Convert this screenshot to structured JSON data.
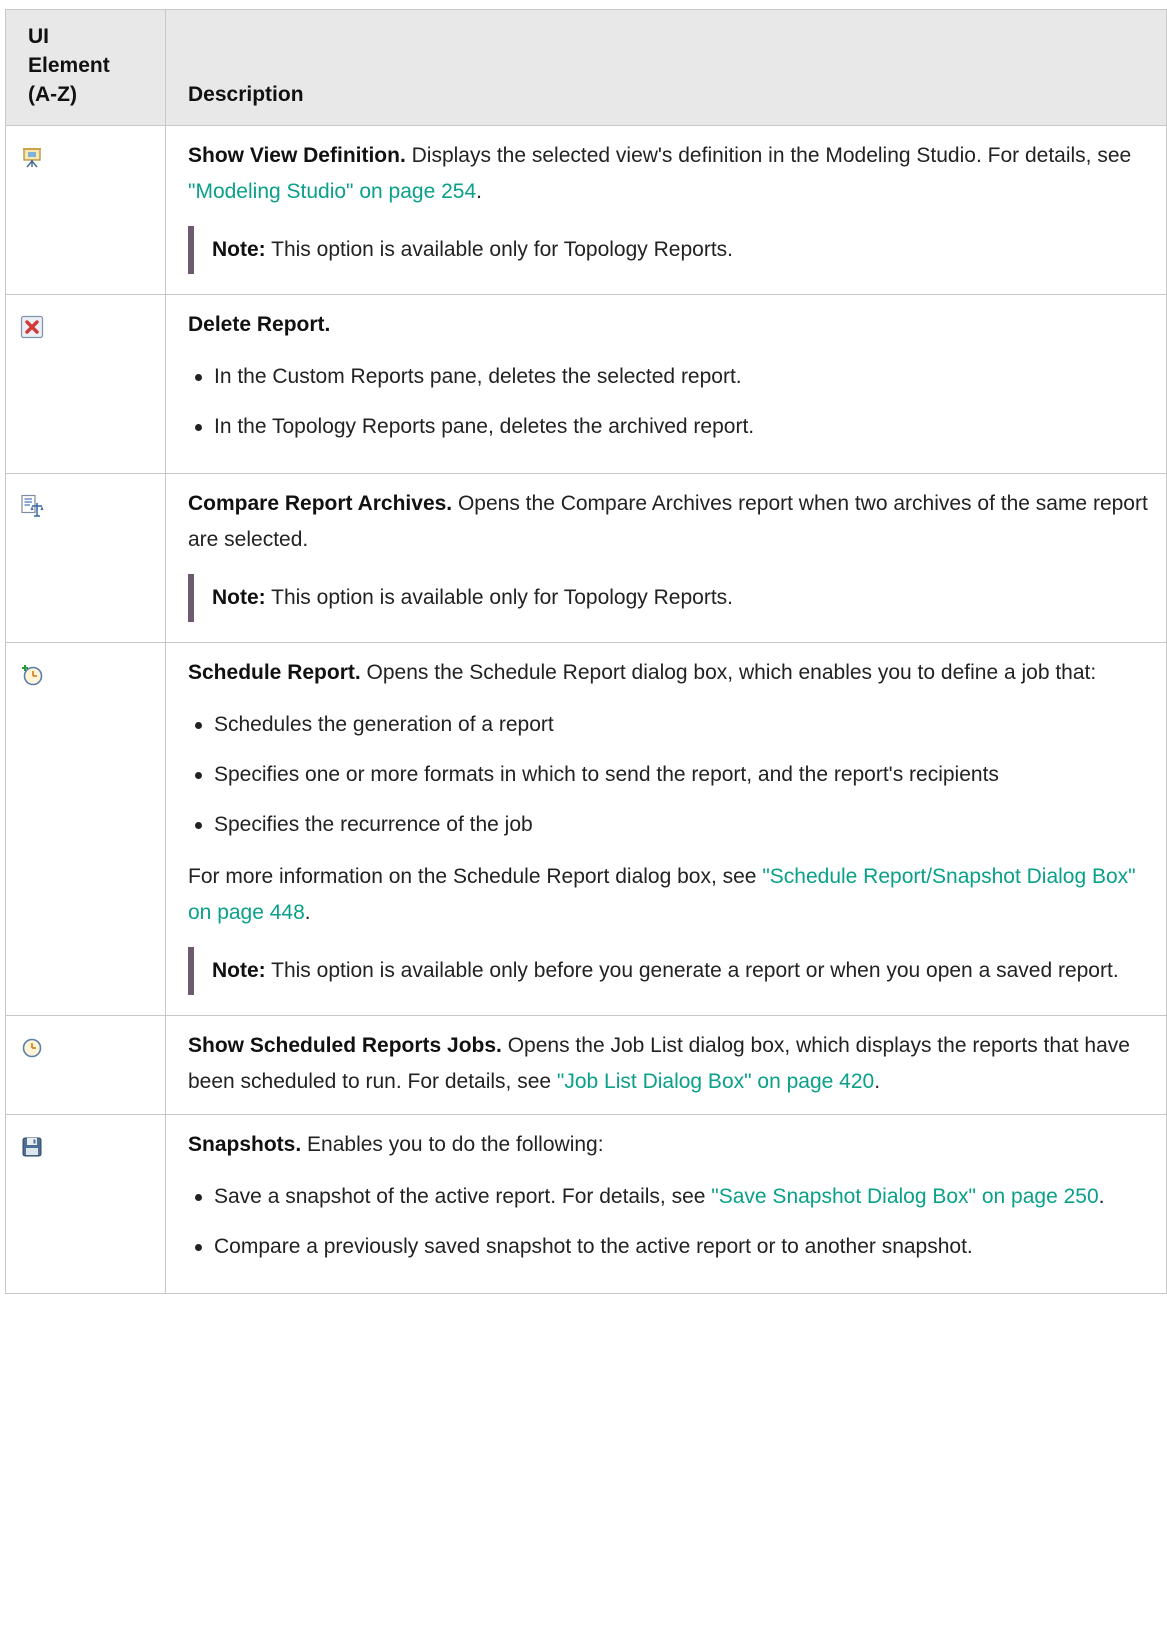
{
  "header": {
    "col1": "UI\nElement\n(A-Z)",
    "col2": "Description"
  },
  "rows": [
    {
      "icon": "presentation-easel-icon",
      "title": "Show View Definition.",
      "text1": " Displays the selected view's definition in the Modeling Studio. For details, see ",
      "link": "\"Modeling Studio\" on page 254",
      "text2": ".",
      "note_label": "Note:",
      "note_text": " This option is available only for Topology Reports."
    },
    {
      "icon": "delete-red-x-icon",
      "title": "Delete Report.",
      "bullets": [
        "In the Custom Reports pane, deletes the selected report.",
        "In the Topology Reports pane, deletes the archived report."
      ]
    },
    {
      "icon": "compare-archives-icon",
      "title": "Compare Report Archives.",
      "text1": " Opens the Compare Archives report when two archives of the same report are selected.",
      "note_label": "Note:",
      "note_text": " This option is available only for Topology Reports."
    },
    {
      "icon": "schedule-clock-plus-icon",
      "title": "Schedule Report.",
      "text1": " Opens the Schedule Report dialog box, which enables you to define a job that:",
      "bullets": [
        "Schedules the generation of a report",
        "Specifies one or more formats in which to send the report, and the report's recipients",
        "Specifies the recurrence of the job"
      ],
      "text3": "For more information on the Schedule Report dialog box, see ",
      "link": "\"Schedule Report/Snapshot Dialog Box\" on page 448",
      "text4": ".",
      "note_label": "Note:",
      "note_text": " This option is available only before you generate a report or when you open a saved report."
    },
    {
      "icon": "scheduled-jobs-clock-icon",
      "title": "Show Scheduled Reports Jobs.",
      "text1": " Opens the Job List dialog box, which displays the reports that have been scheduled to run. For details, see ",
      "link": "\"Job List Dialog Box\" on page 420",
      "text2": "."
    },
    {
      "icon": "snapshot-save-icon",
      "title": "Snapshots.",
      "text1": " Enables you to do the following:",
      "b1_text": "Save a snapshot of the active report. For details, see ",
      "b1_link": "\"Save Snapshot Dialog Box\" on page 250",
      "b1_end": ".",
      "b2_text": "Compare a previously saved snapshot to the active report or to another snapshot."
    }
  ]
}
